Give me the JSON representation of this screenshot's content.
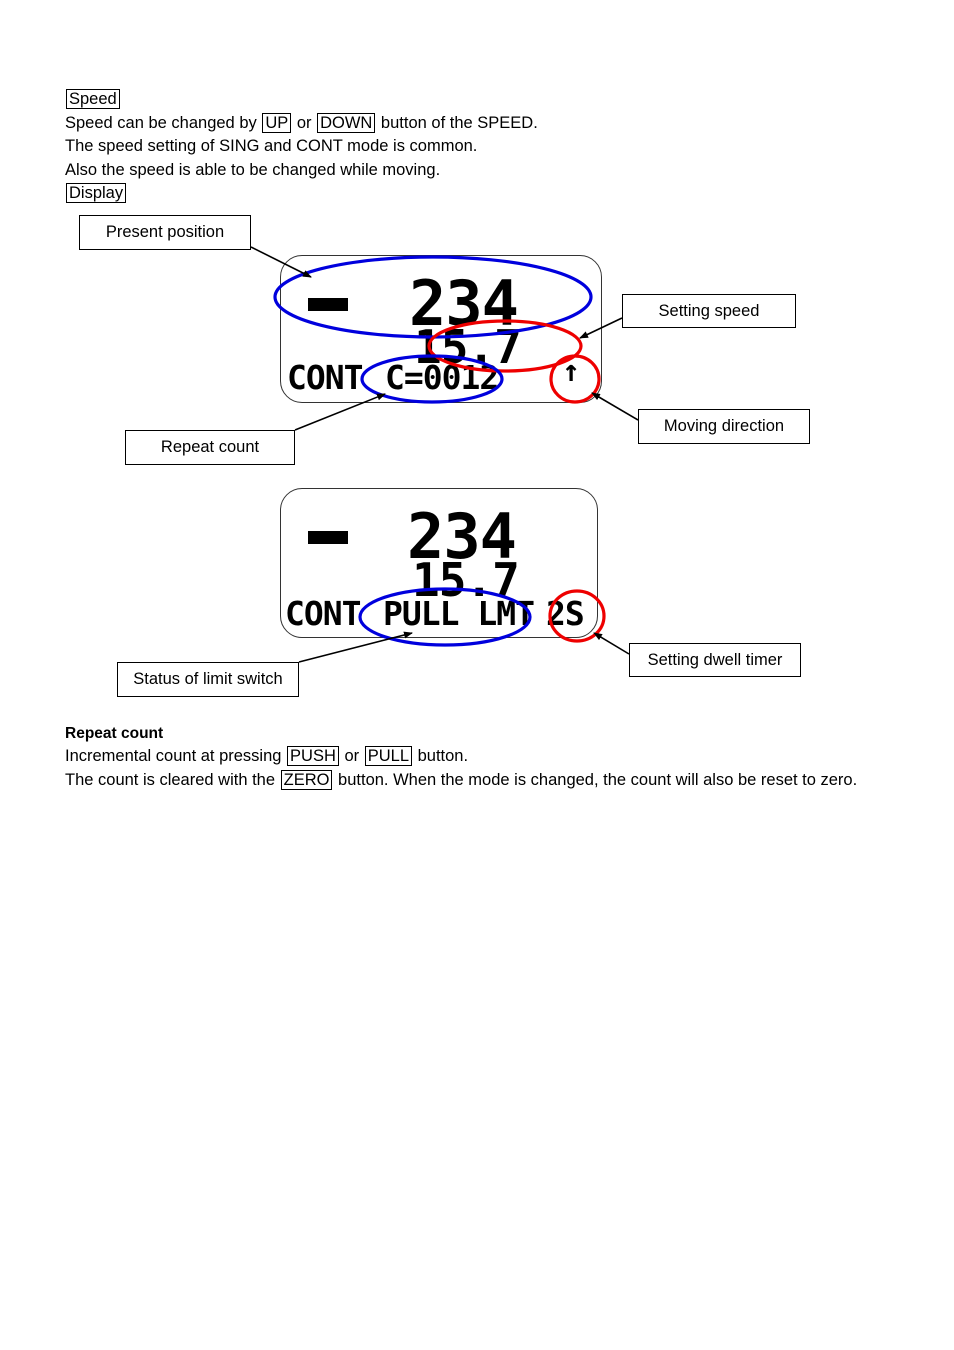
{
  "section_speed": {
    "heading": "Speed",
    "line1_a": "Speed can be changed by ",
    "line1_btn1": "UP",
    "line1_b": " or ",
    "line1_btn2": "DOWN",
    "line1_c": " button of the SPEED.",
    "line2": "The speed setting of SING and CONT mode is common.",
    "line3": "Also the speed is able to be changed while moving.",
    "display_heading": "Display"
  },
  "callouts": {
    "present_position": "Present position",
    "setting_speed": "Setting speed",
    "repeat_count": "Repeat count",
    "moving_direction": "Moving direction",
    "status_limit_switch": "Status of limit switch",
    "setting_dwell_timer": "Setting dwell timer"
  },
  "lcd1": {
    "sign": "-",
    "position": "234",
    "speed": "15.7",
    "mode": "CONT",
    "count": "C=0012",
    "direction_icon": "up-arrow-icon",
    "direction_glyph": "↑"
  },
  "lcd2": {
    "sign": "-",
    "position": "234",
    "speed": "15.7",
    "mode": "CONT",
    "limit_status": "PULL LMT",
    "dwell": "2S"
  },
  "section_repeat": {
    "heading": "Repeat count",
    "line1_a": "Incremental count at pressing ",
    "line1_btn1": "PUSH",
    "line1_b": " or ",
    "line1_btn2": "PULL",
    "line1_c": " button.",
    "line2_a": "The count is cleared with the ",
    "line2_btn": "ZERO",
    "line2_b": " button. When the mode is changed, the count will also be reset to zero."
  },
  "colors": {
    "ellipse_blue": "#0000dd",
    "ellipse_red": "#ee0000",
    "text": "#000000",
    "background": "#ffffff"
  }
}
